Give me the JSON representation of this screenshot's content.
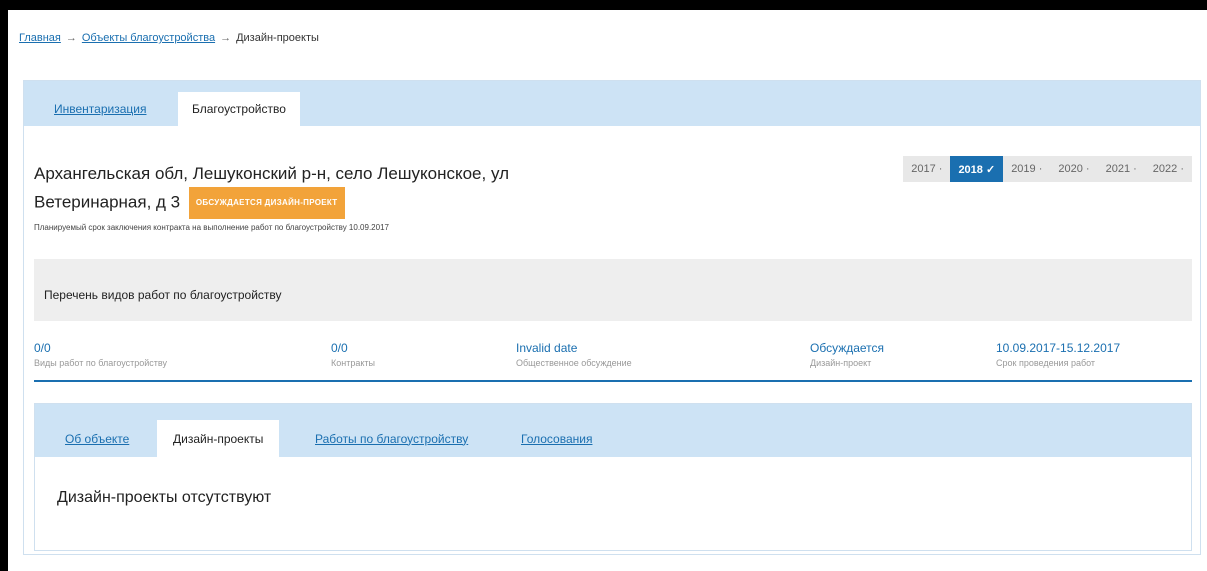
{
  "breadcrumb": {
    "home": "Главная",
    "sep1": "→",
    "objects": "Объекты благоустройства",
    "sep2": "→",
    "current": "Дизайн-проекты"
  },
  "tabs": {
    "inventory": "Инвентаризация",
    "improvement": "Благоустройство"
  },
  "object": {
    "title_line1": "Архангельская обл, Лешуконский р-н, село Лешуконское, ул",
    "title_line2": "Ветеринарная, д 3",
    "status_badge": "ОБСУЖДАЕТСЯ ДИЗАЙН-ПРОЕКТ",
    "planned_note": "Планируемый срок заключения контракта на выполнение работ по благоустройству 10.09.2017"
  },
  "years": [
    {
      "label": "2017 ·"
    },
    {
      "label": "2018 ✓"
    },
    {
      "label": "2019 ·"
    },
    {
      "label": "2020 ·"
    },
    {
      "label": "2021 ·"
    },
    {
      "label": "2022 ·"
    }
  ],
  "work_list_title": "Перечень видов работ по благоустройству",
  "stats": [
    {
      "value": "0/0",
      "label": "Виды работ по благоустройству"
    },
    {
      "value": "0/0",
      "label": "Контракты"
    },
    {
      "value": "Invalid date",
      "label": "Общественное обсуждение"
    },
    {
      "value": "Обсуждается",
      "label": "Дизайн-проект"
    },
    {
      "value": "10.09.2017-15.12.2017",
      "label": "Срок проведения работ"
    }
  ],
  "inner_tabs": {
    "about": "Об объекте",
    "design": "Дизайн-проекты",
    "works": "Работы по благоустройству",
    "voting": "Голосования"
  },
  "empty_message": "Дизайн-проекты отсутствуют",
  "colors": {
    "accent": "#1a6fb0",
    "tab_bar": "#cde3f5",
    "badge": "#f2a33a"
  }
}
